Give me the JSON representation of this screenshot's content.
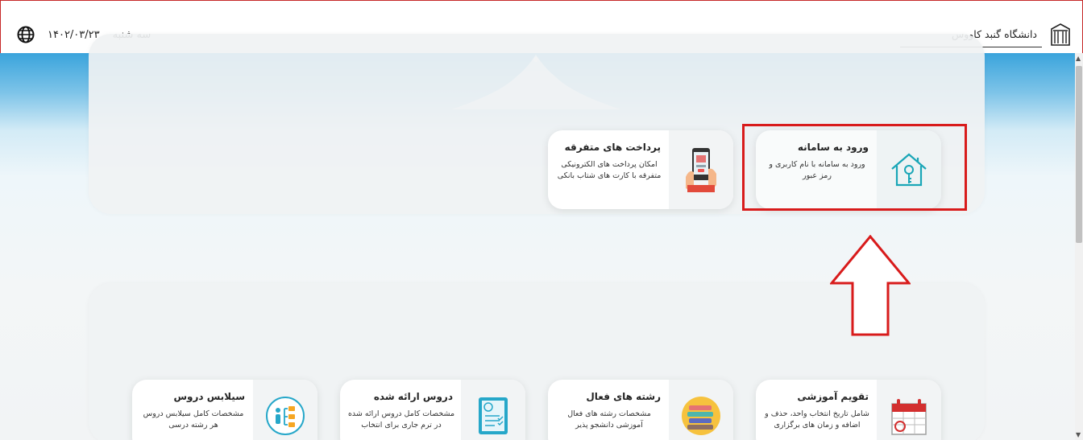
{
  "header": {
    "university_name": "دانشگاه گنبد کاووس",
    "day": "سه شنبه",
    "date": "۱۴۰۲/۰۳/۲۳",
    "logo_icon": "university-building-icon",
    "language_icon": "globe-icon"
  },
  "services_top": [
    {
      "title": "ورود به سامانه",
      "description": "ورود به سامانه با نام کاربری و رمز عبور",
      "icon": "house-key-icon"
    },
    {
      "title": "پرداخت های متفرقه",
      "description": "امکان پرداخت های الکترونیکی متفرقه با کارت های شتاب بانکی",
      "icon": "mobile-payment-icon"
    }
  ],
  "services_bottom": [
    {
      "title": "تقویم آموزشی",
      "description": "شامل تاریخ انتخاب واحد، حذف و اضافه و زمان های برگزاری",
      "icon": "calendar-icon"
    },
    {
      "title": "رشته های فعال",
      "description": "مشخصات رشته های فعال آموزشی دانشجو پذیر",
      "icon": "books-icon"
    },
    {
      "title": "دروس ارائه شده",
      "description": "مشخصات کامل دروس ارائه شده در ترم جاری برای انتخاب",
      "icon": "checklist-icon"
    },
    {
      "title": "سیلابس دروس",
      "description": "مشخصات کامل سیلابس دروس هر رشته درسی",
      "icon": "tree-structure-icon"
    }
  ],
  "colors": {
    "highlight": "#d81b1b",
    "sky": "#3aa4dc"
  }
}
